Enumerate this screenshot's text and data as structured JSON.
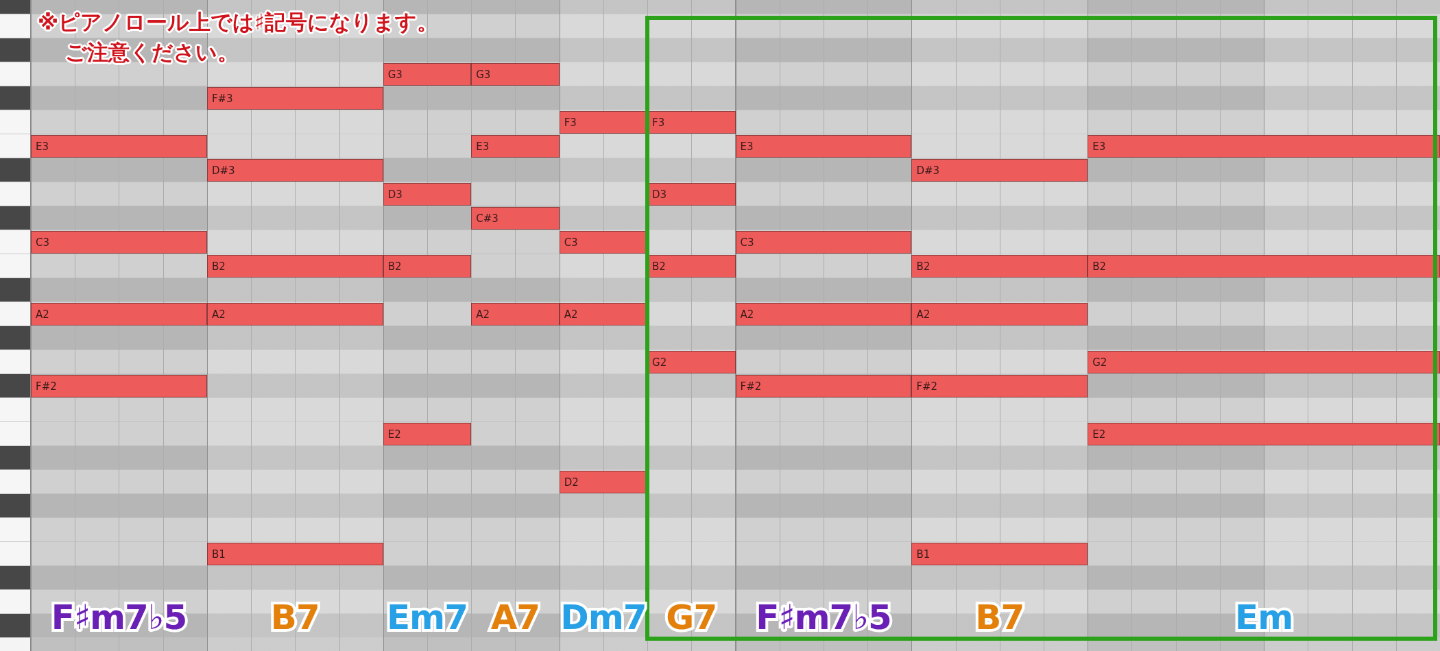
{
  "annotation": {
    "lines": [
      "※ピアノロール上では♯記号になります。",
      "ご注意ください。"
    ]
  },
  "segments": [
    {
      "chord": "F♯m7♭5",
      "color": "#6a1fb5",
      "kind": "whole",
      "framed": false,
      "notes": [
        "E3",
        "C3",
        "A2",
        "F#2"
      ]
    },
    {
      "chord": "B7",
      "color": "#e3800c",
      "kind": "whole",
      "framed": false,
      "notes": [
        "F#3",
        "D#3",
        "B2",
        "A2",
        "B1"
      ]
    },
    {
      "chord": "Em7",
      "color": "#27a0e6",
      "kind": "half",
      "framed": false,
      "notes": [
        "G3",
        "D3",
        "B2",
        "E2"
      ]
    },
    {
      "chord": "A7",
      "color": "#e3800c",
      "kind": "half",
      "framed": false,
      "notes": [
        "G3",
        "E3",
        "C#3",
        "A2"
      ]
    },
    {
      "chord": "Dm7",
      "color": "#27a0e6",
      "kind": "half",
      "framed": false,
      "notes": [
        "F3",
        "C3",
        "A2",
        "D2"
      ]
    },
    {
      "chord": "G7",
      "color": "#e3800c",
      "kind": "half",
      "framed": true,
      "notes": [
        "F3",
        "D3",
        "B2",
        "G2"
      ]
    },
    {
      "chord": "F♯m7♭5",
      "color": "#6a1fb5",
      "kind": "whole",
      "framed": true,
      "notes": [
        "E3",
        "C3",
        "A2",
        "F#2"
      ]
    },
    {
      "chord": "B7",
      "color": "#e3800c",
      "kind": "whole",
      "framed": true,
      "notes": [
        "D#3",
        "B2",
        "A2",
        "F#2",
        "B1"
      ]
    },
    {
      "chord": "Em",
      "color": "#27a0e6",
      "kind": "breve",
      "framed": true,
      "notes": [
        "E3",
        "B2",
        "G2",
        "E2"
      ]
    }
  ]
}
